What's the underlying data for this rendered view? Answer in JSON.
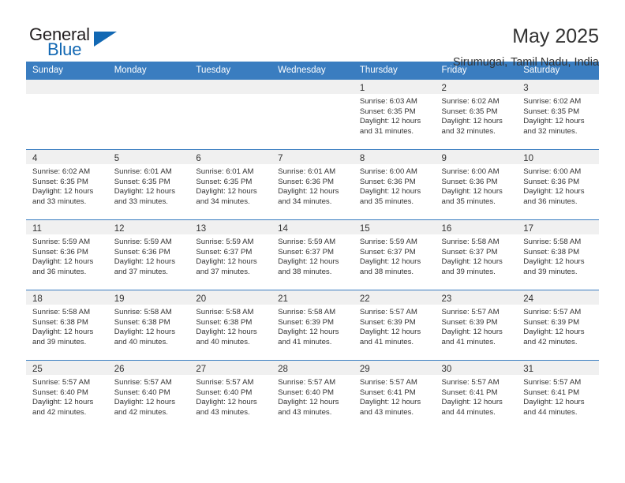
{
  "brand": {
    "name_top": "General",
    "name_bottom": "Blue",
    "triangle_icon": "brand-triangle-icon",
    "color_blue": "#1268b3",
    "color_dark": "#231f20"
  },
  "header": {
    "title": "May 2025",
    "subtitle": "Sirumugai, Tamil Nadu, India"
  },
  "calendar": {
    "accent_color": "#3a7dc0",
    "daynum_band_color": "#f0f0f0",
    "weekday_headers": [
      "Sunday",
      "Monday",
      "Tuesday",
      "Wednesday",
      "Thursday",
      "Friday",
      "Saturday"
    ],
    "weeks": [
      [
        {
          "day": "",
          "lines": []
        },
        {
          "day": "",
          "lines": []
        },
        {
          "day": "",
          "lines": []
        },
        {
          "day": "",
          "lines": []
        },
        {
          "day": "1",
          "lines": [
            "Sunrise: 6:03 AM",
            "Sunset: 6:35 PM",
            "Daylight: 12 hours and 31 minutes."
          ]
        },
        {
          "day": "2",
          "lines": [
            "Sunrise: 6:02 AM",
            "Sunset: 6:35 PM",
            "Daylight: 12 hours and 32 minutes."
          ]
        },
        {
          "day": "3",
          "lines": [
            "Sunrise: 6:02 AM",
            "Sunset: 6:35 PM",
            "Daylight: 12 hours and 32 minutes."
          ]
        }
      ],
      [
        {
          "day": "4",
          "lines": [
            "Sunrise: 6:02 AM",
            "Sunset: 6:35 PM",
            "Daylight: 12 hours and 33 minutes."
          ]
        },
        {
          "day": "5",
          "lines": [
            "Sunrise: 6:01 AM",
            "Sunset: 6:35 PM",
            "Daylight: 12 hours and 33 minutes."
          ]
        },
        {
          "day": "6",
          "lines": [
            "Sunrise: 6:01 AM",
            "Sunset: 6:35 PM",
            "Daylight: 12 hours and 34 minutes."
          ]
        },
        {
          "day": "7",
          "lines": [
            "Sunrise: 6:01 AM",
            "Sunset: 6:36 PM",
            "Daylight: 12 hours and 34 minutes."
          ]
        },
        {
          "day": "8",
          "lines": [
            "Sunrise: 6:00 AM",
            "Sunset: 6:36 PM",
            "Daylight: 12 hours and 35 minutes."
          ]
        },
        {
          "day": "9",
          "lines": [
            "Sunrise: 6:00 AM",
            "Sunset: 6:36 PM",
            "Daylight: 12 hours and 35 minutes."
          ]
        },
        {
          "day": "10",
          "lines": [
            "Sunrise: 6:00 AM",
            "Sunset: 6:36 PM",
            "Daylight: 12 hours and 36 minutes."
          ]
        }
      ],
      [
        {
          "day": "11",
          "lines": [
            "Sunrise: 5:59 AM",
            "Sunset: 6:36 PM",
            "Daylight: 12 hours and 36 minutes."
          ]
        },
        {
          "day": "12",
          "lines": [
            "Sunrise: 5:59 AM",
            "Sunset: 6:36 PM",
            "Daylight: 12 hours and 37 minutes."
          ]
        },
        {
          "day": "13",
          "lines": [
            "Sunrise: 5:59 AM",
            "Sunset: 6:37 PM",
            "Daylight: 12 hours and 37 minutes."
          ]
        },
        {
          "day": "14",
          "lines": [
            "Sunrise: 5:59 AM",
            "Sunset: 6:37 PM",
            "Daylight: 12 hours and 38 minutes."
          ]
        },
        {
          "day": "15",
          "lines": [
            "Sunrise: 5:59 AM",
            "Sunset: 6:37 PM",
            "Daylight: 12 hours and 38 minutes."
          ]
        },
        {
          "day": "16",
          "lines": [
            "Sunrise: 5:58 AM",
            "Sunset: 6:37 PM",
            "Daylight: 12 hours and 39 minutes."
          ]
        },
        {
          "day": "17",
          "lines": [
            "Sunrise: 5:58 AM",
            "Sunset: 6:38 PM",
            "Daylight: 12 hours and 39 minutes."
          ]
        }
      ],
      [
        {
          "day": "18",
          "lines": [
            "Sunrise: 5:58 AM",
            "Sunset: 6:38 PM",
            "Daylight: 12 hours and 39 minutes."
          ]
        },
        {
          "day": "19",
          "lines": [
            "Sunrise: 5:58 AM",
            "Sunset: 6:38 PM",
            "Daylight: 12 hours and 40 minutes."
          ]
        },
        {
          "day": "20",
          "lines": [
            "Sunrise: 5:58 AM",
            "Sunset: 6:38 PM",
            "Daylight: 12 hours and 40 minutes."
          ]
        },
        {
          "day": "21",
          "lines": [
            "Sunrise: 5:58 AM",
            "Sunset: 6:39 PM",
            "Daylight: 12 hours and 41 minutes."
          ]
        },
        {
          "day": "22",
          "lines": [
            "Sunrise: 5:57 AM",
            "Sunset: 6:39 PM",
            "Daylight: 12 hours and 41 minutes."
          ]
        },
        {
          "day": "23",
          "lines": [
            "Sunrise: 5:57 AM",
            "Sunset: 6:39 PM",
            "Daylight: 12 hours and 41 minutes."
          ]
        },
        {
          "day": "24",
          "lines": [
            "Sunrise: 5:57 AM",
            "Sunset: 6:39 PM",
            "Daylight: 12 hours and 42 minutes."
          ]
        }
      ],
      [
        {
          "day": "25",
          "lines": [
            "Sunrise: 5:57 AM",
            "Sunset: 6:40 PM",
            "Daylight: 12 hours and 42 minutes."
          ]
        },
        {
          "day": "26",
          "lines": [
            "Sunrise: 5:57 AM",
            "Sunset: 6:40 PM",
            "Daylight: 12 hours and 42 minutes."
          ]
        },
        {
          "day": "27",
          "lines": [
            "Sunrise: 5:57 AM",
            "Sunset: 6:40 PM",
            "Daylight: 12 hours and 43 minutes."
          ]
        },
        {
          "day": "28",
          "lines": [
            "Sunrise: 5:57 AM",
            "Sunset: 6:40 PM",
            "Daylight: 12 hours and 43 minutes."
          ]
        },
        {
          "day": "29",
          "lines": [
            "Sunrise: 5:57 AM",
            "Sunset: 6:41 PM",
            "Daylight: 12 hours and 43 minutes."
          ]
        },
        {
          "day": "30",
          "lines": [
            "Sunrise: 5:57 AM",
            "Sunset: 6:41 PM",
            "Daylight: 12 hours and 44 minutes."
          ]
        },
        {
          "day": "31",
          "lines": [
            "Sunrise: 5:57 AM",
            "Sunset: 6:41 PM",
            "Daylight: 12 hours and 44 minutes."
          ]
        }
      ]
    ]
  }
}
